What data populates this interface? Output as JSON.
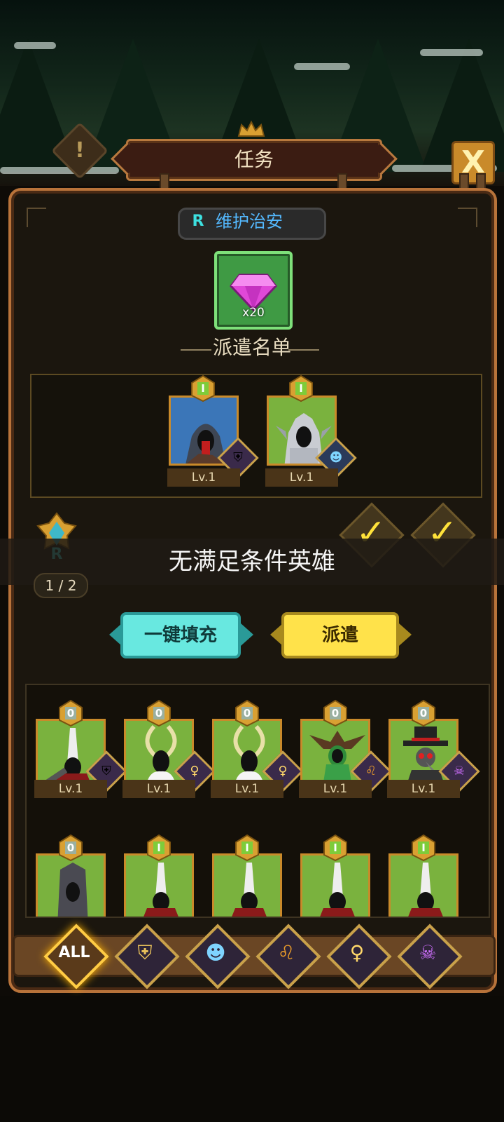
{
  "header": {
    "title": "任务",
    "close_label": "X",
    "warning_label": "!"
  },
  "mission": {
    "rarity": "R",
    "name": "维护治安",
    "reward_qty": "x20",
    "reward_icon": "gem-icon"
  },
  "dispatch": {
    "title": "派遣名单",
    "heroes": [
      {
        "rank": "I",
        "level": "Lv.1",
        "faction": "knight-faction-icon",
        "art": "hooded-red-mask-hero"
      },
      {
        "rank": "I",
        "level": "Lv.1",
        "faction": "merfolk-faction-icon",
        "art": "armored-spiky-knight-hero"
      }
    ]
  },
  "requirement": {
    "rarity": "R",
    "count": "1 / 2",
    "checks": 2
  },
  "toast": "无满足条件英雄",
  "buttons": {
    "autofill": "一键填充",
    "send": "派遣"
  },
  "roster": {
    "row1": [
      {
        "rank": "0",
        "level": "Lv.1",
        "faction": "knight"
      },
      {
        "rank": "0",
        "level": "Lv.1",
        "faction": "elf"
      },
      {
        "rank": "0",
        "level": "Lv.1",
        "faction": "elf"
      },
      {
        "rank": "0",
        "level": "Lv.1",
        "faction": "beast"
      },
      {
        "rank": "0",
        "level": "Lv.1",
        "faction": "demon"
      }
    ],
    "row2": [
      {
        "rank": "0"
      },
      {
        "rank": "I"
      },
      {
        "rank": "I"
      },
      {
        "rank": "I"
      },
      {
        "rank": "I"
      }
    ]
  },
  "tabs": [
    {
      "label": "ALL",
      "icon": "all-icon",
      "active": true
    },
    {
      "label": "",
      "icon": "knight-helmet-icon"
    },
    {
      "label": "",
      "icon": "merfolk-icon"
    },
    {
      "label": "",
      "icon": "lion-icon"
    },
    {
      "label": "",
      "icon": "elf-icon"
    },
    {
      "label": "",
      "icon": "demon-skull-icon"
    }
  ],
  "colors": {
    "panel_border": "#b8733a",
    "mission_name": "#54b9ff",
    "autofill_btn": "#68e8e0",
    "send_btn": "#ffe24a"
  }
}
